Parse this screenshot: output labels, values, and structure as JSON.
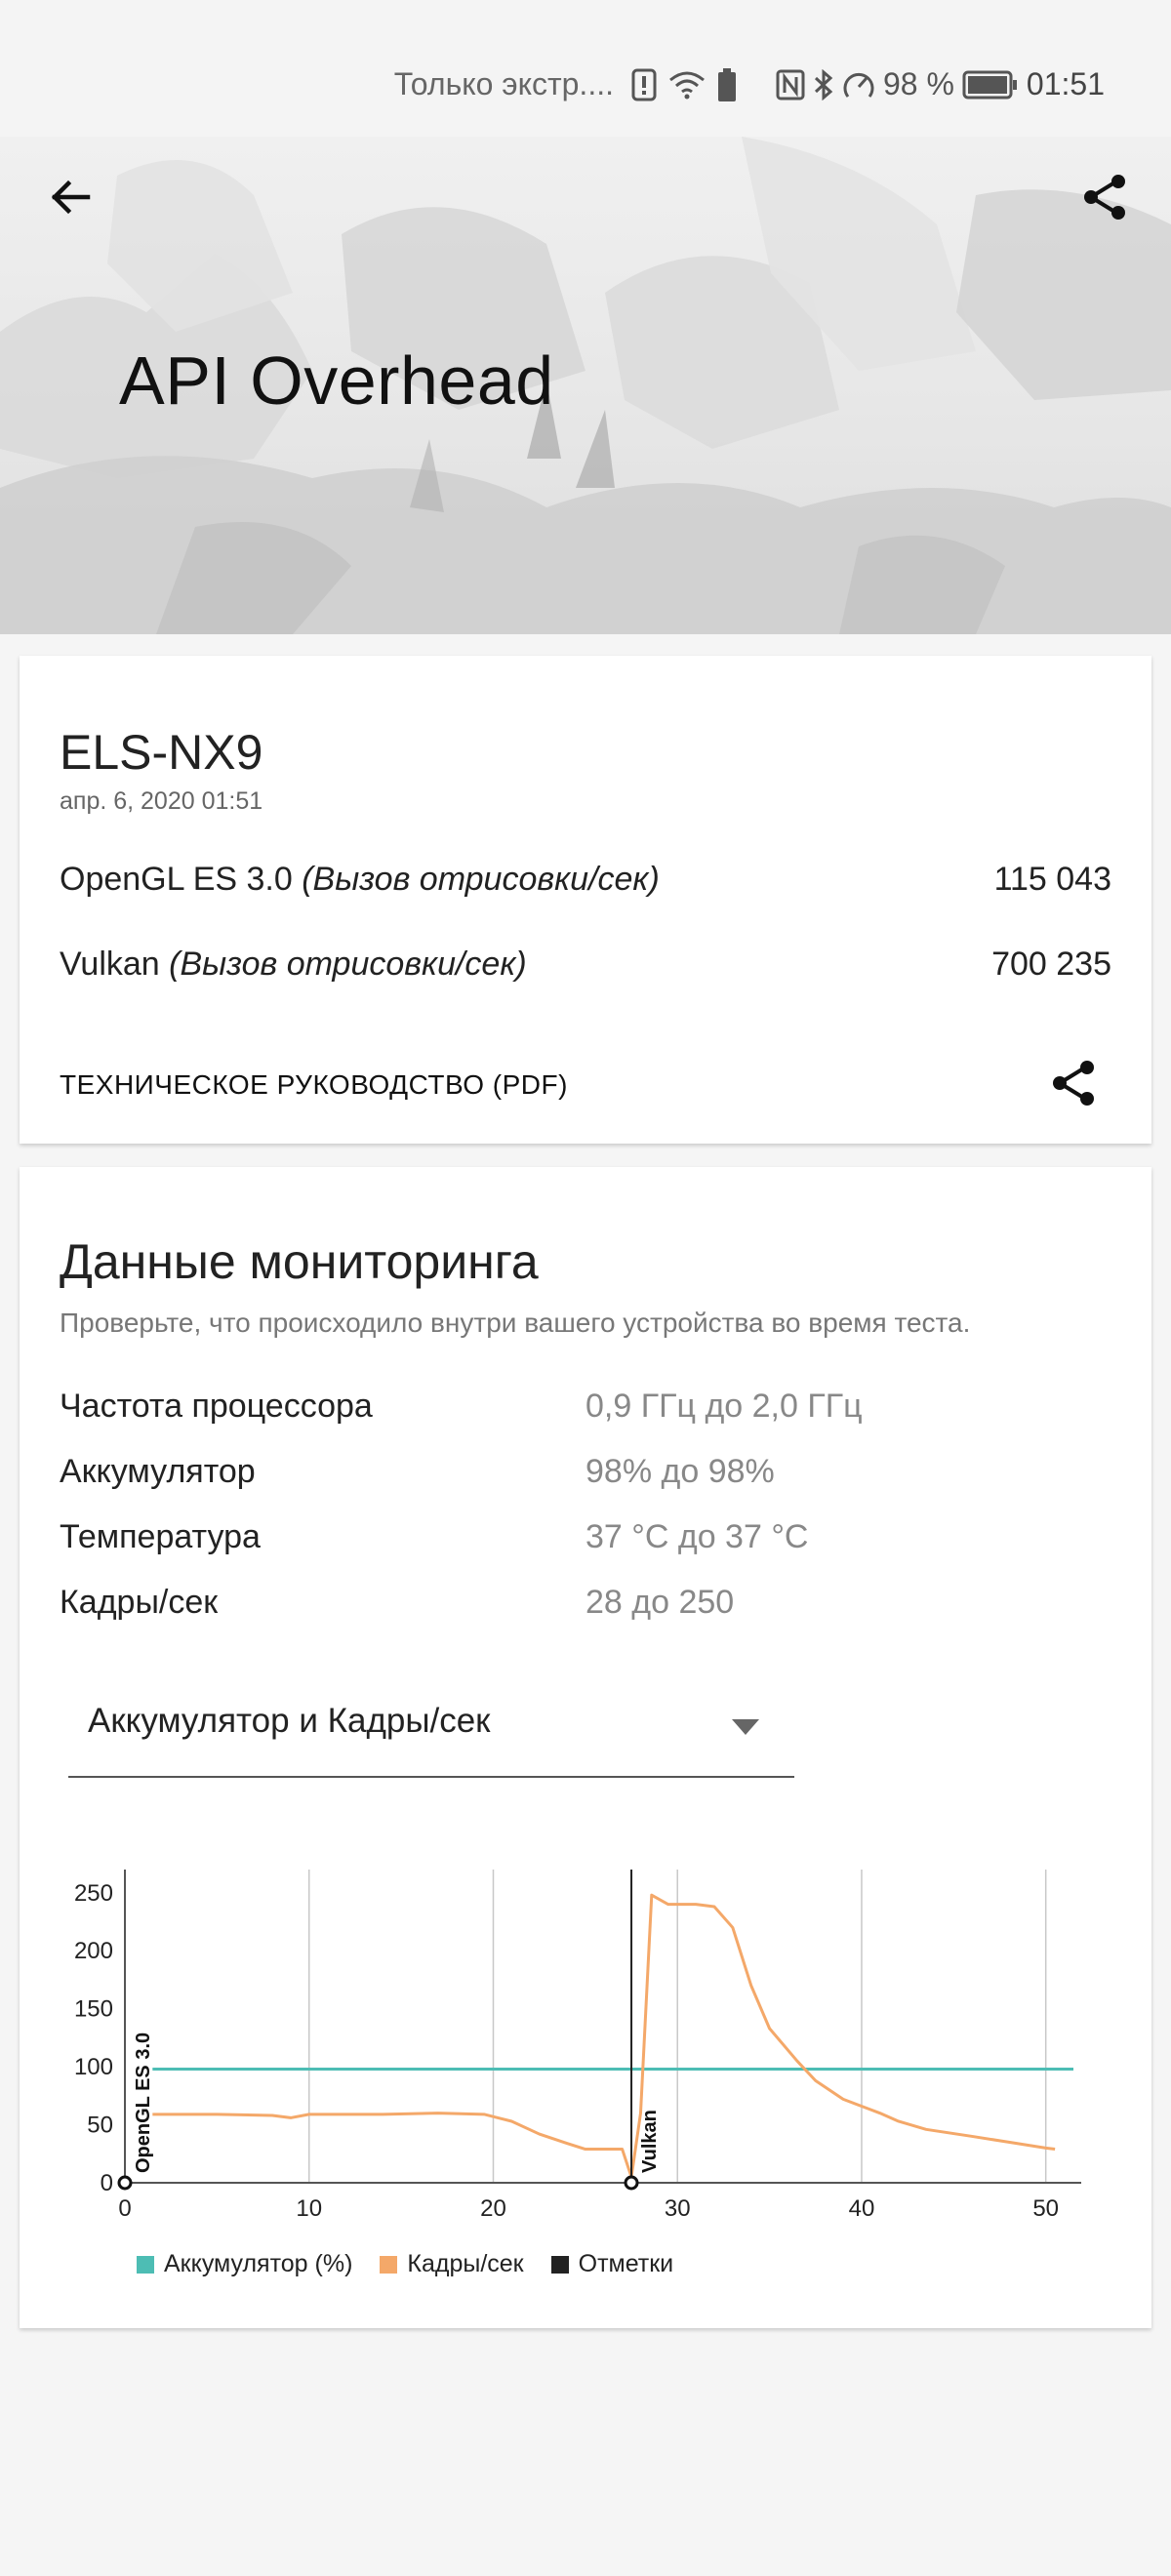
{
  "status_bar": {
    "carrier": "Только экстр....",
    "battery_percent": "98 %",
    "time": "01:51"
  },
  "hero": {
    "title": "API Overhead",
    "back_icon": "arrow-left-icon",
    "share_icon": "share-icon"
  },
  "result_card": {
    "device": "ELS-NX9",
    "date": "апр. 6, 2020 01:51",
    "scores": [
      {
        "api": "OpenGL ES 3.0",
        "unit": "(Вызов отрисовки/сек)",
        "value": "115 043"
      },
      {
        "api": "Vulkan",
        "unit": "(Вызов отрисовки/сек)",
        "value": "700 235"
      }
    ],
    "pdf_link": "ТЕХНИЧЕСКОЕ РУКОВОДСТВО (PDF)"
  },
  "monitoring": {
    "title": "Данные мониторинга",
    "subtitle": "Проверьте, что происходило внутри вашего устройства во время теста.",
    "metrics": [
      {
        "label": "Частота процессора",
        "value": "0,9 ГГц до 2,0 ГГц"
      },
      {
        "label": "Аккумулятор",
        "value": "98% до 98%"
      },
      {
        "label": "Температура",
        "value": "37 °C до 37 °C"
      },
      {
        "label": "Кадры/сек",
        "value": "28 до 250"
      }
    ],
    "dropdown_selected": "Аккумулятор и Кадры/сек"
  },
  "chart_data": {
    "type": "line",
    "xlim": [
      0,
      51.5
    ],
    "ylim": [
      0,
      270
    ],
    "x_ticks": [
      "0",
      "10",
      "20",
      "30",
      "40",
      "50"
    ],
    "y_ticks": [
      "0",
      "50",
      "100",
      "150",
      "200",
      "250"
    ],
    "grid": "vertical",
    "legend_position": "bottom",
    "series": [
      {
        "name": "Аккумулятор (%)",
        "color": "#4dbdb4",
        "points": [
          [
            1.5,
            98
          ],
          [
            51.5,
            98
          ]
        ]
      },
      {
        "name": "Кадры/сек",
        "color": "#f4a869",
        "points": [
          [
            1.5,
            59
          ],
          [
            5,
            59
          ],
          [
            8,
            58
          ],
          [
            9,
            56
          ],
          [
            10,
            59
          ],
          [
            14,
            59
          ],
          [
            17,
            60
          ],
          [
            19.5,
            59
          ],
          [
            21,
            53
          ],
          [
            22.5,
            42
          ],
          [
            24,
            34
          ],
          [
            25,
            29
          ],
          [
            27,
            29
          ],
          [
            27.5,
            5
          ],
          [
            28,
            60
          ],
          [
            28.6,
            248
          ],
          [
            29.5,
            240
          ],
          [
            31,
            240
          ],
          [
            32,
            238
          ],
          [
            33,
            220
          ],
          [
            34,
            170
          ],
          [
            35,
            133
          ],
          [
            36.5,
            105
          ],
          [
            37.5,
            88
          ],
          [
            39,
            72
          ],
          [
            41,
            60
          ],
          [
            42,
            53
          ],
          [
            43.5,
            46
          ],
          [
            46,
            40
          ],
          [
            48,
            35
          ],
          [
            50,
            30
          ],
          [
            50.5,
            29
          ]
        ]
      },
      {
        "name": "Отметки",
        "color": "#222222",
        "markers": [
          {
            "x": 0,
            "label": "OpenGL ES 3.0"
          },
          {
            "x": 27.5,
            "label": "Vulkan"
          }
        ]
      }
    ]
  }
}
